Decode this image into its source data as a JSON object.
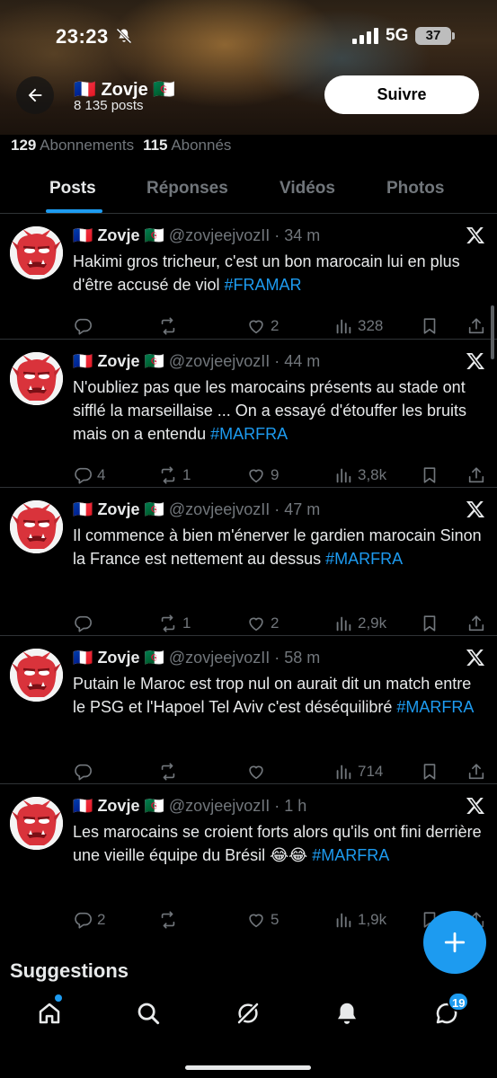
{
  "status_bar": {
    "time": "23:23",
    "network": "5G",
    "battery": "37"
  },
  "profile": {
    "flag_left": "🇫🇷",
    "name": "Zovje",
    "flag_right": "🇩🇿",
    "posts_count": "8 135 posts",
    "follow_label": "Suivre",
    "following_count": "129",
    "following_label": "Abonnements",
    "followers_count": "115",
    "followers_label": "Abonnés"
  },
  "tabs": [
    {
      "label": "Posts",
      "active": true
    },
    {
      "label": "Réponses",
      "active": false
    },
    {
      "label": "Vidéos",
      "active": false
    },
    {
      "label": "Photos",
      "active": false
    }
  ],
  "posts": [
    {
      "name": "Zovje",
      "handle": "@zovjeejvozII",
      "time": "34 m",
      "text": "Hakimi gros tricheur, c'est un bon marocain lui en plus d'être accusé de viol ",
      "hashtag": "#FRAMAR",
      "replies": "",
      "reposts": "",
      "likes": "2",
      "views": "328"
    },
    {
      "name": "Zovje",
      "handle": "@zovjeejvozII",
      "time": "44 m",
      "text": "N'oubliez pas que les marocains présents au stade ont sifflé la marseillaise ... On a essayé d'étouffer les bruits mais on a entendu ",
      "hashtag": "#MARFRA",
      "replies": "4",
      "reposts": "1",
      "likes": "9",
      "views": "3,8k"
    },
    {
      "name": "Zovje",
      "handle": "@zovjeejvozII",
      "time": "47 m",
      "text": "Il commence à bien m'énerver le gardien marocain Sinon la France est nettement au dessus ",
      "hashtag": "#MARFRA",
      "replies": "",
      "reposts": "1",
      "likes": "2",
      "views": "2,9k"
    },
    {
      "name": "Zovje",
      "handle": "@zovjeejvozII",
      "time": "58 m",
      "text": "Putain le Maroc est trop nul on aurait dit un match entre le PSG et l'Hapoel Tel Aviv c'est déséquilibré ",
      "hashtag": "#MARFRA",
      "replies": "",
      "reposts": "",
      "likes": "",
      "views": "714"
    },
    {
      "name": "Zovje",
      "handle": "@zovjeejvozII",
      "time": "1 h",
      "text": "Les marocains se croient forts alors qu'ils ont fini derrière une vieille équipe du Brésil 😂😂 ",
      "hashtag": "#MARFRA",
      "replies": "2",
      "reposts": "",
      "likes": "5",
      "views": "1,9k"
    }
  ],
  "suggestions_label": "Suggestions",
  "bottom_nav": {
    "messages_badge": "19"
  },
  "colors": {
    "accent": "#1d9bf0",
    "background": "#000000",
    "text": "#e7e9ea",
    "muted": "#71767b"
  }
}
